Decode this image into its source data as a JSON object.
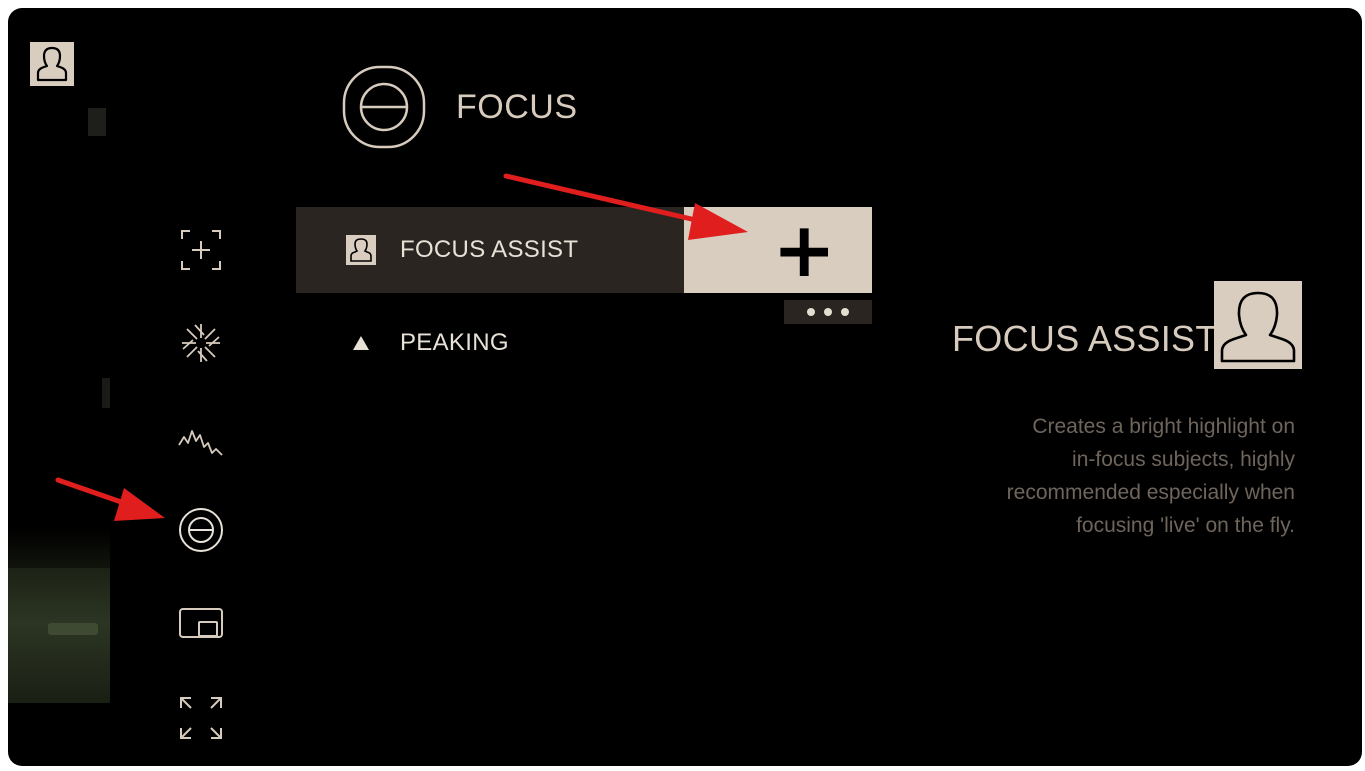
{
  "header": {
    "title": "FOCUS",
    "icon": "focus-icon"
  },
  "sidebar": {
    "profile_icon": "user-profile-icon",
    "items": [
      {
        "name": "crosshair-plus-icon",
        "active": false
      },
      {
        "name": "aperture-icon",
        "active": false
      },
      {
        "name": "waveform-icon",
        "active": false
      },
      {
        "name": "focus-icon",
        "active": true
      },
      {
        "name": "picture-in-picture-icon",
        "active": false
      },
      {
        "name": "fullscreen-icon",
        "active": false
      }
    ]
  },
  "menu": {
    "items": [
      {
        "label": "FOCUS ASSIST",
        "icon": "user-icon",
        "selected": true
      },
      {
        "label": "PEAKING",
        "icon": "triangle-icon",
        "selected": false
      }
    ],
    "add_label": "+",
    "more_label": "•••"
  },
  "detail": {
    "title": "FOCUS ASSIST",
    "description_lines": [
      "Creates a bright highlight on",
      "in-focus subjects, highly",
      "recommended especially when",
      "focusing 'live' on the fly."
    ]
  },
  "colors": {
    "background": "#000000",
    "accent": "#d9cdbf",
    "selected_row": "#2a2520",
    "text_primary": "#e8e1d7",
    "text_muted": "#6e655c",
    "annotation_arrow": "#e01e1e"
  }
}
